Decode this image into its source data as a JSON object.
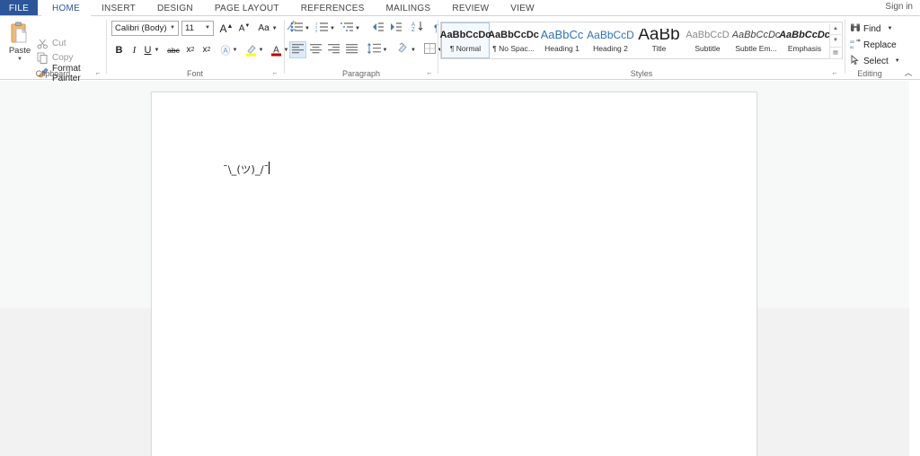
{
  "window": {
    "signin_label": "Sign in"
  },
  "ribbon_tabs": {
    "file_label": "FILE",
    "items": [
      {
        "label": "HOME",
        "active": true
      },
      {
        "label": "INSERT",
        "active": false
      },
      {
        "label": "DESIGN",
        "active": false
      },
      {
        "label": "PAGE LAYOUT",
        "active": false
      },
      {
        "label": "REFERENCES",
        "active": false
      },
      {
        "label": "MAILINGS",
        "active": false
      },
      {
        "label": "REVIEW",
        "active": false
      },
      {
        "label": "VIEW",
        "active": false
      }
    ]
  },
  "clipboard": {
    "group_label": "Clipboard",
    "paste_label": "Paste",
    "paste_icon": "clipboard-icon",
    "cut_label": "Cut",
    "cut_icon": "scissors-icon",
    "copy_label": "Copy",
    "copy_icon": "copy-icon",
    "format_painter_label": "Format Painter",
    "format_painter_icon": "paintbrush-icon",
    "launcher_icon": "dialog-launcher-icon"
  },
  "font": {
    "group_label": "Font",
    "font_name_value": "Calibri (Body)",
    "font_size_value": "11",
    "grow_font_icon": "grow-font-icon",
    "shrink_font_icon": "shrink-font-icon",
    "change_case_label": "Aa",
    "clear_formatting_icon": "clear-formatting-icon",
    "bold_label": "B",
    "italic_label": "I",
    "underline_label": "U",
    "strikethrough_label": "abc",
    "subscript_label": "x",
    "subscript_sub": "2",
    "superscript_label": "x",
    "superscript_sup": "2",
    "text_effects_icon": "text-effects-icon",
    "highlight_icon": "highlight-color-icon",
    "font_color_icon": "font-color-icon",
    "highlight_color": "#ffff00",
    "font_color": "#c00000",
    "launcher_icon": "dialog-launcher-icon"
  },
  "paragraph": {
    "group_label": "Paragraph",
    "bullets_icon": "bullet-list-icon",
    "numbering_icon": "numbered-list-icon",
    "multilevel_icon": "multilevel-list-icon",
    "decrease_indent_icon": "decrease-indent-icon",
    "increase_indent_icon": "increase-indent-icon",
    "sort_icon": "sort-icon",
    "show_marks_icon": "paragraph-mark-icon",
    "align_left_icon": "align-left-icon",
    "align_center_icon": "align-center-icon",
    "align_right_icon": "align-right-icon",
    "justify_icon": "justify-icon",
    "line_spacing_icon": "line-spacing-icon",
    "shading_icon": "shading-icon",
    "borders_icon": "borders-icon",
    "launcher_icon": "dialog-launcher-icon"
  },
  "styles": {
    "group_label": "Styles",
    "launcher_icon": "dialog-launcher-icon",
    "scroll_up_icon": "scroll-up-icon",
    "scroll_down_icon": "scroll-down-icon",
    "more_icon": "more-styles-icon",
    "items": [
      {
        "sample": "AaBbCcDc",
        "name": "¶ Normal",
        "selected": true,
        "color": "#1f1f1f",
        "size": "11px",
        "weight": "bold",
        "style": "normal"
      },
      {
        "sample": "AaBbCcDc",
        "name": "¶ No Spac...",
        "selected": false,
        "color": "#1f1f1f",
        "size": "11px",
        "weight": "bold",
        "style": "normal"
      },
      {
        "sample": "AaBbCc",
        "name": "Heading 1",
        "selected": false,
        "color": "#2e74b5",
        "size": "13px",
        "weight": "normal",
        "style": "normal"
      },
      {
        "sample": "AaBbCcD",
        "name": "Heading 2",
        "selected": false,
        "color": "#2e74b5",
        "size": "12px",
        "weight": "normal",
        "style": "normal"
      },
      {
        "sample": "AaBb",
        "name": "Title",
        "selected": false,
        "color": "#1f1f1f",
        "size": "19px",
        "weight": "normal",
        "style": "normal"
      },
      {
        "sample": "AaBbCcD",
        "name": "Subtitle",
        "selected": false,
        "color": "#8a8a8a",
        "size": "11px",
        "weight": "normal",
        "style": "normal"
      },
      {
        "sample": "AaBbCcDc",
        "name": "Subtle Em...",
        "selected": false,
        "color": "#404040",
        "size": "11px",
        "weight": "normal",
        "style": "italic"
      },
      {
        "sample": "AaBbCcDc",
        "name": "Emphasis",
        "selected": false,
        "color": "#1f1f1f",
        "size": "11px",
        "weight": "bold",
        "style": "italic"
      }
    ]
  },
  "editing": {
    "group_label": "Editing",
    "find_label": "Find",
    "find_icon": "binoculars-icon",
    "replace_label": "Replace",
    "replace_icon": "replace-icon",
    "select_label": "Select",
    "select_icon": "cursor-select-icon",
    "collapse_icon": "chevron-up-icon"
  },
  "document": {
    "body_text": "¯\\_(ツ)_/¯"
  }
}
